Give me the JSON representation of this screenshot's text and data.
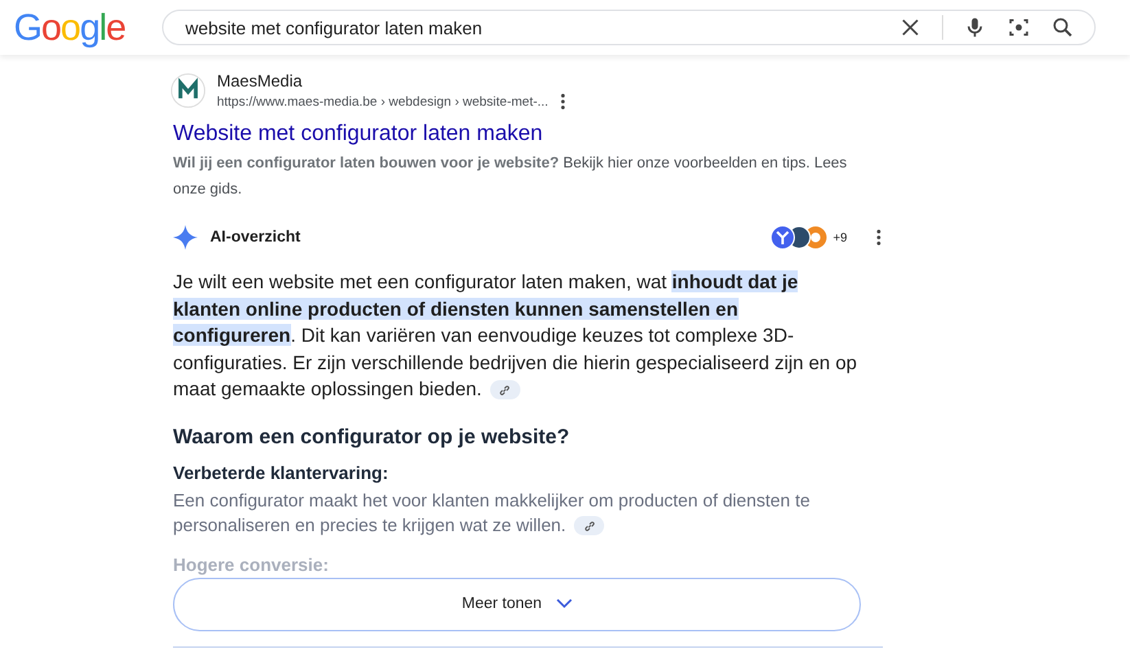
{
  "header": {
    "logo": "Google",
    "search": {
      "value": "website met configurator laten maken"
    }
  },
  "result": {
    "site_name": "MaesMedia",
    "url": "https://www.maes-media.be › webdesign › website-met-...",
    "title": "Website met configurator laten maken",
    "snippet": "**Wil jij een configurator laten bouwen voor je website?** Bekijk hier onze voorbeelden en tips. Lees onze gids."
  },
  "ai_overview": {
    "title": "AI-overzicht",
    "source_count": "+9",
    "summary": [
      {
        "text": "Je wilt een website met een configurator laten maken, wat ",
        "highlighted": false
      },
      {
        "text": "inhoudt dat je klanten online producten of diensten kunnen samenstellen en configureren",
        "highlighted": true
      },
      {
        "text": ". Dit kan variëren van eenvoudige keuzes tot complexe 3D-configuraties. Er zijn verschillende bedrijven die hierin gespecialiseerd zijn en op maat gemaakte oplossingen bieden.",
        "highlighted": false
      }
    ],
    "section_heading": "Waarom een configurator op je website?",
    "points": [
      {
        "heading": "Verbeterde klantervaring:",
        "text": "Een configurator maakt het voor klanten makkelijker om producten of diensten te personaliseren en precies te krijgen wat ze willen.",
        "faded": false
      },
      {
        "heading": "Hogere conversie:",
        "faded": true
      }
    ],
    "more_button": "Meer tonen"
  }
}
